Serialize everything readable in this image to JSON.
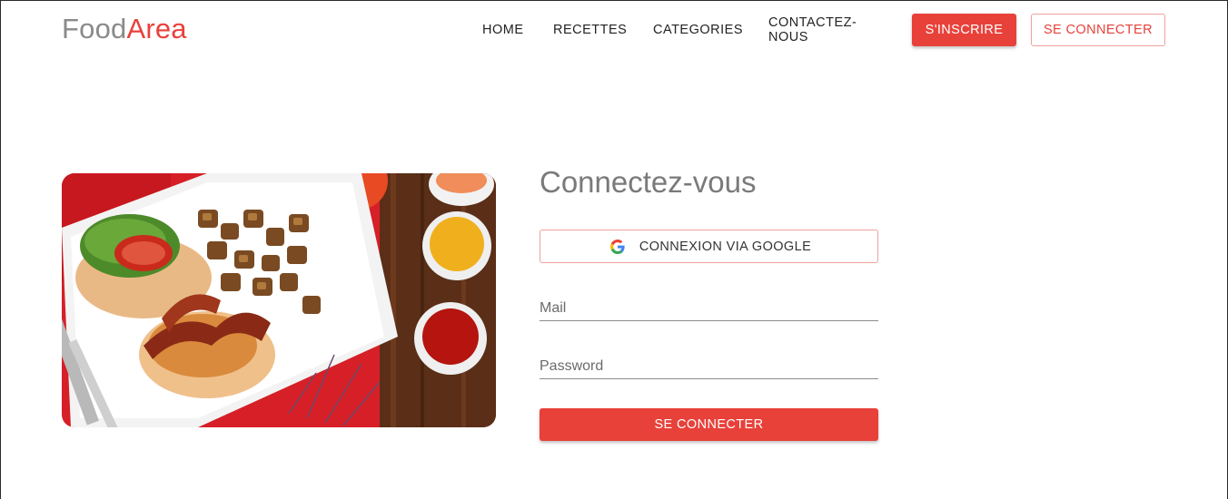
{
  "brand": {
    "part1": "Food",
    "part2": "Area"
  },
  "nav": {
    "home": "HOME",
    "recettes": "RECETTES",
    "categories": "CATEGORIES",
    "contact": "CONTACTEZ-NOUS"
  },
  "header_buttons": {
    "signup": "S'INSCRIRE",
    "login": "SE CONNECTER"
  },
  "login_form": {
    "title": "Connectez-vous",
    "google_label": "CONNEXION VIA GOOGLE",
    "mail_placeholder": "Mail",
    "password_placeholder": "Password",
    "submit_label": "SE CONNECTER"
  },
  "icons": {
    "google": "google-g-icon"
  },
  "colors": {
    "accent": "#e8413a",
    "accent_border": "#eea19c",
    "title_gray": "#7a7a7a",
    "logo_gray": "#8a8a8a"
  }
}
